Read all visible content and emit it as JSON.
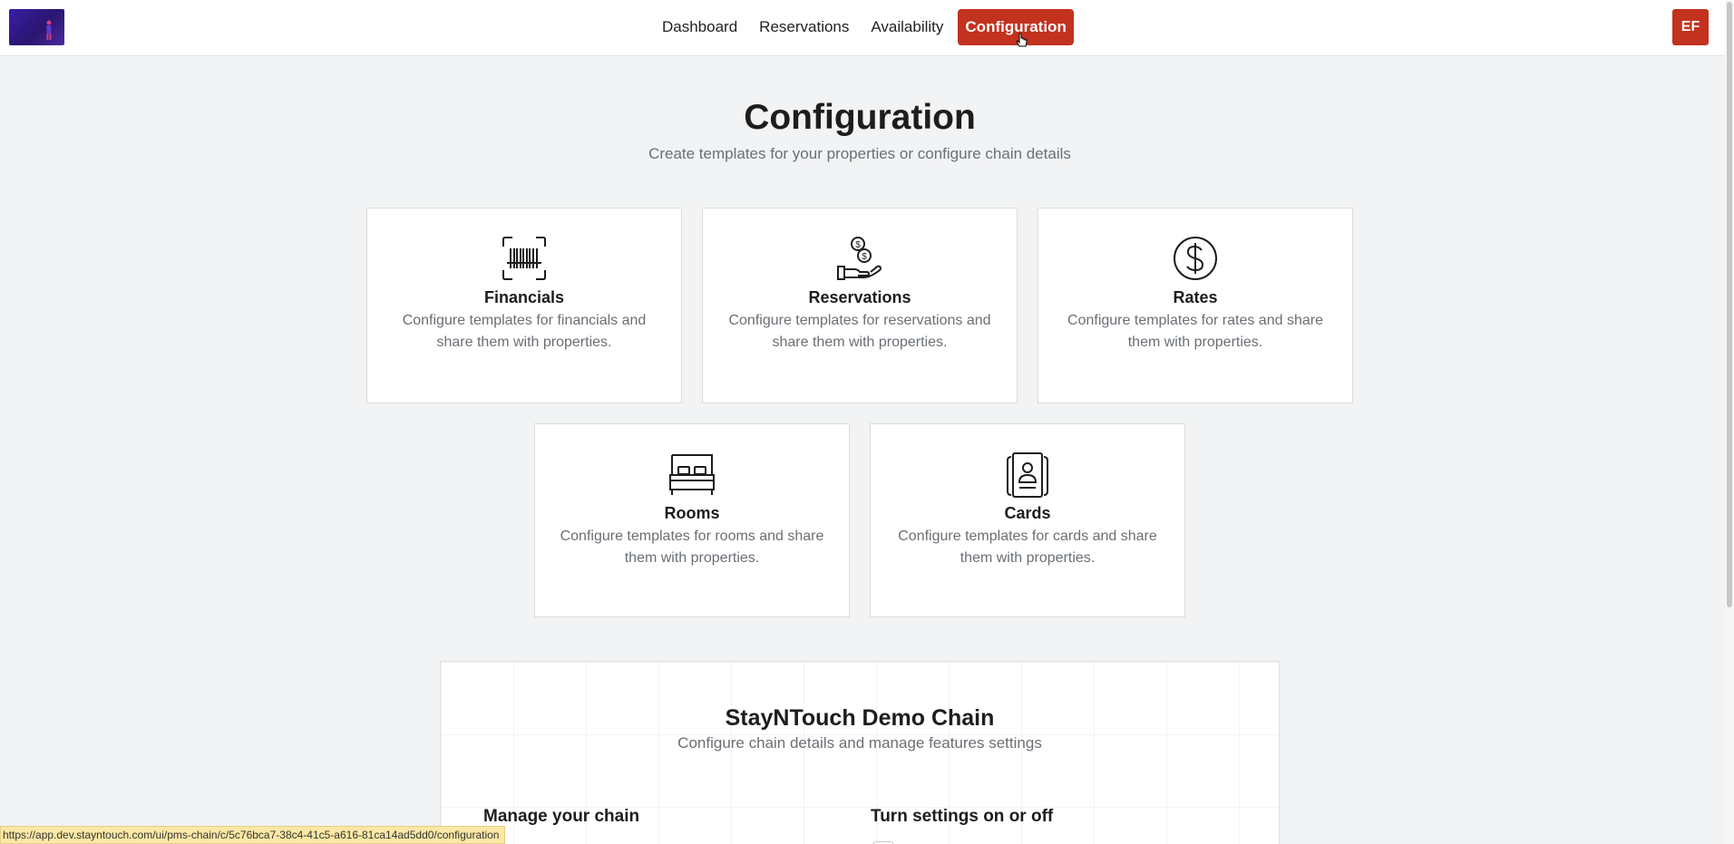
{
  "nav": {
    "items": [
      "Dashboard",
      "Reservations",
      "Availability"
    ],
    "active": "Configuration"
  },
  "user": {
    "initials": "EF"
  },
  "header": {
    "title": "Configuration",
    "subtitle": "Create templates for your properties or configure chain details"
  },
  "cards": [
    {
      "title": "Financials",
      "desc": "Configure templates for financials and share them with properties.",
      "icon": "barcode-icon"
    },
    {
      "title": "Reservations",
      "desc": "Configure templates for reservations and share them with properties.",
      "icon": "hand-coins-icon"
    },
    {
      "title": "Rates",
      "desc": "Configure templates for rates and share them with properties.",
      "icon": "dollar-circle-icon"
    },
    {
      "title": "Rooms",
      "desc": "Configure templates for rooms and share them with properties.",
      "icon": "bed-icon"
    },
    {
      "title": "Cards",
      "desc": "Configure templates for cards and share them with properties.",
      "icon": "id-card-icon"
    }
  ],
  "chain": {
    "title": "StayNTouch Demo Chain",
    "subtitle": "Configure chain details and manage features settings",
    "manage_heading": "Manage your chain",
    "settings_heading": "Turn settings on or off"
  },
  "status_url": "https://app.dev.stayntouch.com/ui/pms-chain/c/5c76bca7-38c4-41c5-a616-81ca14ad5dd0/configuration",
  "colors": {
    "accent": "#c2321f",
    "background": "#f2f3f4"
  }
}
